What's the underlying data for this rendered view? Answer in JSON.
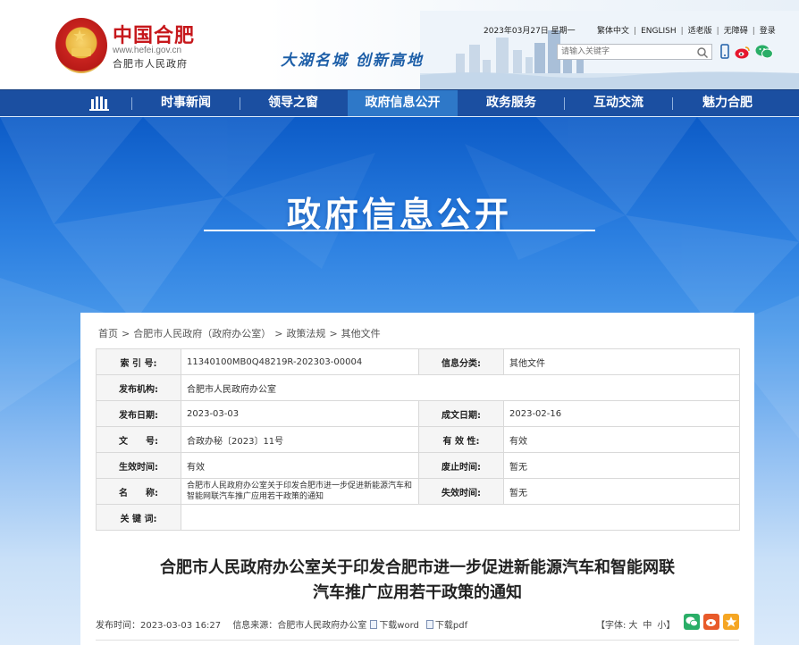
{
  "header": {
    "logo_cn": "中国合肥",
    "logo_url": "www.hefei.gov.cn",
    "logo_sub": "合肥市人民政府",
    "slogan": "大湖名城  创新高地",
    "date": "2023年03月27日 星期一",
    "links": [
      "繁体中文",
      "ENGLISH",
      "适老版",
      "无障碍",
      "登录"
    ],
    "search_placeholder": "请输入关键字",
    "icons": [
      "search-icon",
      "mobile-icon",
      "weibo-icon",
      "wechat-icon"
    ]
  },
  "nav": {
    "items": [
      "时事新闻",
      "领导之窗",
      "政府信息公开",
      "政务服务",
      "互动交流",
      "魅力合肥"
    ],
    "active_index": 2
  },
  "banner": {
    "title": "政府信息公开"
  },
  "breadcrumb": [
    "首页",
    "合肥市人民政府（政府办公室）",
    "政策法规",
    "其他文件"
  ],
  "meta": {
    "index_label": "索 引 号:",
    "index_value": "11340100MB0Q48219R-202303-00004",
    "category_label": "信息分类:",
    "category_value": "其他文件",
    "publisher_label": "发布机构:",
    "publisher_value": "合肥市人民政府办公室",
    "pub_date_label": "发布日期:",
    "pub_date_value": "2023-03-03",
    "create_date_label": "成文日期:",
    "create_date_value": "2023-02-16",
    "docno_label": "文　　号:",
    "docno_value": "合政办秘〔2023〕11号",
    "validity_label": "有 效 性:",
    "validity_value": "有效",
    "effective_label": "生效时间:",
    "effective_value": "有效",
    "abolish_label": "废止时间:",
    "abolish_value": "暂无",
    "name_label": "名　　称:",
    "name_value": "合肥市人民政府办公室关于印发合肥市进一步促进新能源汽车和智能网联汽车推广应用若干政策的通知",
    "invalid_label": "失效时间:",
    "invalid_value": "暂无",
    "keyword_label": "关 键 词:",
    "keyword_value": ""
  },
  "document": {
    "title_line1": "合肥市人民政府办公室关于印发合肥市进一步促进新能源汽车和智能网联",
    "title_line2": "汽车推广应用若干政策的通知",
    "pub_time_label": "发布时间：",
    "pub_time": "2023-03-03 16:27",
    "source_label": "信息来源：",
    "source": "合肥市人民政府办公室",
    "download_word": "下载word",
    "download_pdf": "下载pdf",
    "font_label": "【字体:",
    "font_large": "大",
    "font_medium": "中",
    "font_small": "小】",
    "share_icons": [
      "wechat-share-icon",
      "weibo-share-icon",
      "favorite-icon"
    ]
  },
  "colors": {
    "nav_bg": "#1b4fa1",
    "nav_active": "#2e78c8",
    "logo_red": "#c6171b",
    "banner_top": "#0c5bc7"
  }
}
